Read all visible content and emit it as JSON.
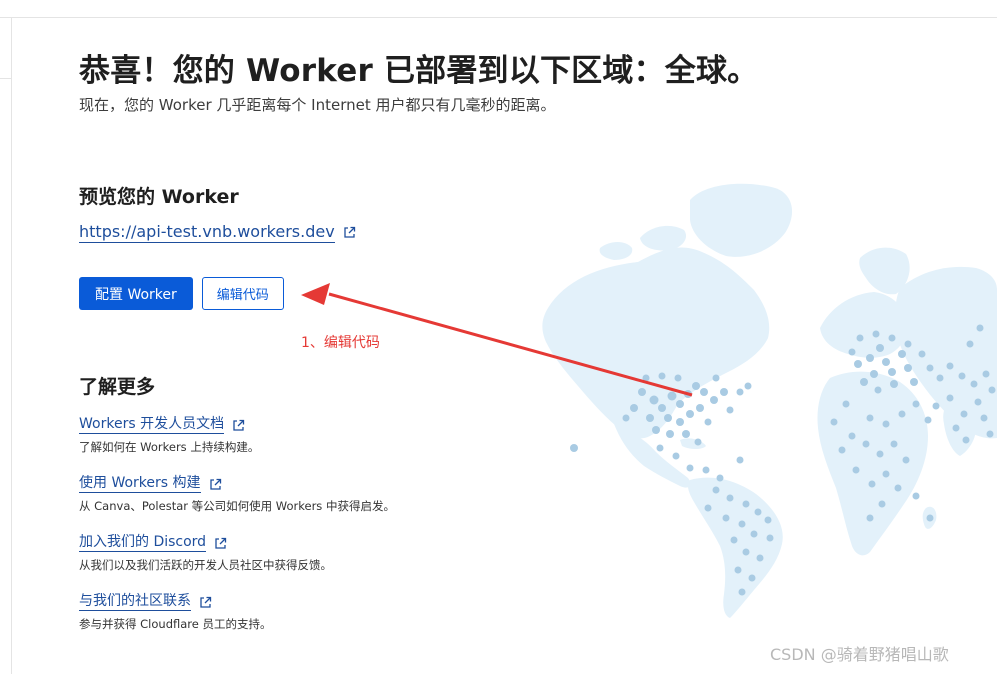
{
  "header": {
    "title": "恭喜！您的 Worker 已部署到以下区域：全球。",
    "subtitle": "现在，您的 Worker 几乎距离每个 Internet 用户都只有几毫秒的距离。"
  },
  "preview": {
    "title": "预览您的 Worker",
    "url": "https://api-test.vnb.workers.dev",
    "link_icon": "external-link-icon"
  },
  "actions": {
    "configure_label": "配置 Worker",
    "edit_code_label": "编辑代码"
  },
  "annotation": {
    "label": "1、编辑代码",
    "color": "#e53935"
  },
  "learn_more": {
    "title": "了解更多",
    "items": [
      {
        "link": "Workers 开发人员文档",
        "desc": "了解如何在 Workers 上持续构建。"
      },
      {
        "link": "使用 Workers 构建",
        "desc": "从 Canva、Polestar 等公司如何使用 Workers 中获得启发。"
      },
      {
        "link": "加入我们的 Discord",
        "desc": "从我们以及我们活跃的开发人员社区中获得反馈。"
      },
      {
        "link": "与我们的社区联系",
        "desc": "参与并获得 Cloudflare 员工的支持。"
      }
    ]
  },
  "watermark": "CSDN @骑着野猪唱山歌",
  "colors": {
    "accent": "#0a5bd8",
    "link": "#1e4e9c",
    "map_land": "#e3f1fa",
    "map_dot": "#a9cbe3"
  }
}
